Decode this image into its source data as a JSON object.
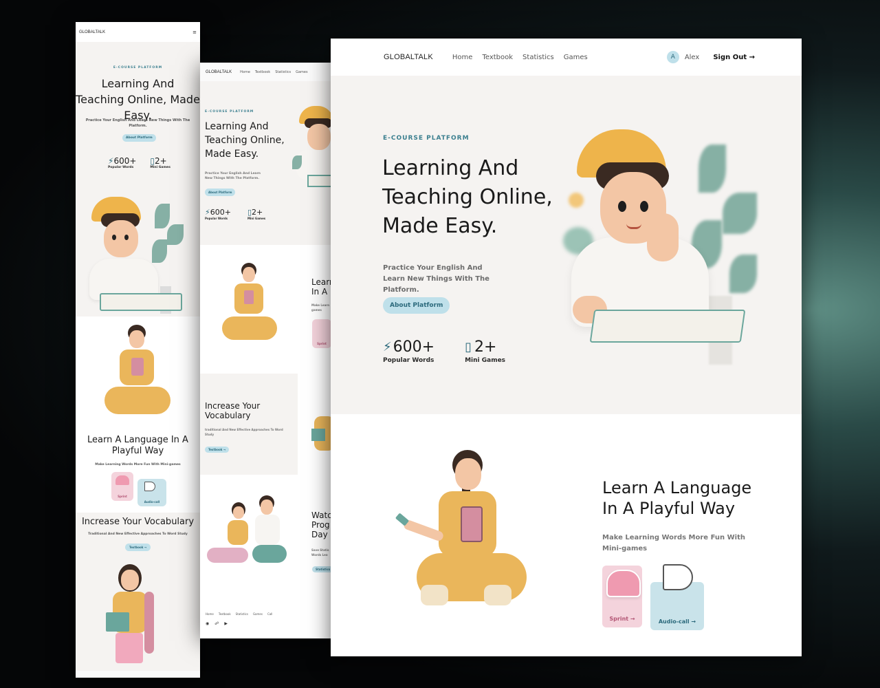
{
  "brand": "GLOBALTALK",
  "nav": {
    "items": [
      "Home",
      "Textbook",
      "Statistics",
      "Games"
    ],
    "avatar_letter": "A",
    "user": "Alex",
    "signout": "Sign Out"
  },
  "hero": {
    "eyebrow": "E-COURSE PLATFORM",
    "title": "Learning And Teaching Online, Made Easy.",
    "subtitle": "Practice Your English And Learn New Things With The Platform.",
    "button": "About Platform",
    "stats": [
      {
        "value": "600+",
        "label": "Popular Words",
        "icon": "lightning-icon"
      },
      {
        "value": "2+",
        "label": "Mini Games",
        "icon": "gamepad-icon"
      }
    ]
  },
  "play": {
    "title": "Learn A Language In A Playful Way",
    "subtitle": "Make Learning Words More Fun With Mini-games",
    "cards": [
      {
        "label": "Sprint",
        "icon": "sneaker-icon",
        "color": "#f4d3dc"
      },
      {
        "label": "Audio-call",
        "icon": "megaphone-icon",
        "color": "#c9e3ea"
      }
    ]
  },
  "vocab": {
    "title": "Increase Your Vocabulary",
    "subtitle": "Traditional And New Effective Approaches To Word Study",
    "button": "Textbook"
  },
  "tablet_partials": {
    "play_title": "Learn In A",
    "play_sub": "Make Learn games",
    "play_card": "Sprint",
    "vocab_sub": "traditional And New Effective Approaches To Word Study",
    "watch_title": "Watc Prog Day",
    "watch_sub": "Save Statis Words Lea",
    "watch_button": "Statistics"
  },
  "footer": {
    "items": [
      "Home",
      "Textbook",
      "Statistics",
      "Games",
      "Call"
    ]
  },
  "colors": {
    "accent": "#3b7f8f",
    "pill_bg": "#bfe0ea",
    "hero_bg": "#f5f3f1"
  }
}
